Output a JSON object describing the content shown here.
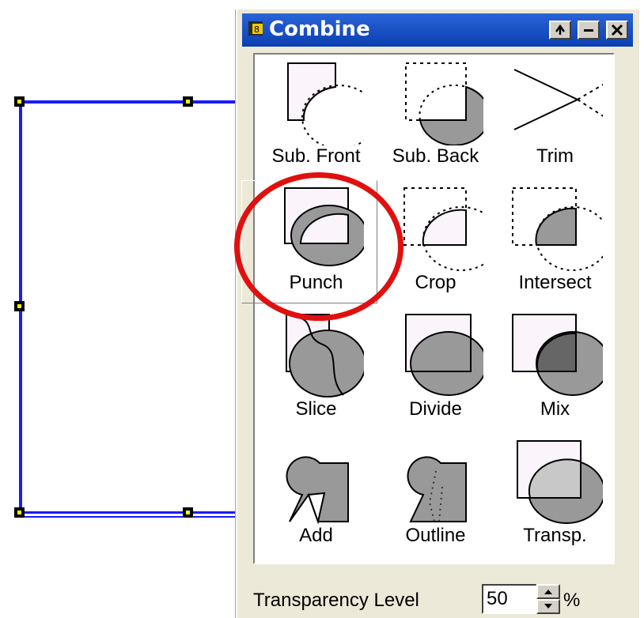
{
  "panel": {
    "title": "Combine",
    "buttons": [
      "pin-icon",
      "minimize-icon",
      "close-icon"
    ]
  },
  "operations": [
    {
      "label": "Sub. Front"
    },
    {
      "label": "Sub. Back"
    },
    {
      "label": "Trim"
    },
    {
      "label": "Punch"
    },
    {
      "label": "Crop"
    },
    {
      "label": "Intersect"
    },
    {
      "label": "Slice"
    },
    {
      "label": "Divide"
    },
    {
      "label": "Mix"
    },
    {
      "label": "Add"
    },
    {
      "label": "Outline"
    },
    {
      "label": "Transp."
    }
  ],
  "footer": {
    "label": "Transparency Level",
    "value": "50",
    "unit": "%"
  },
  "colors": {
    "titlebar": "#0a3fb0",
    "selection": "#1a1aff",
    "highlight": "#e01010",
    "shape_fill": "#9a9a9a",
    "light_fill": "#fbf4fb"
  }
}
